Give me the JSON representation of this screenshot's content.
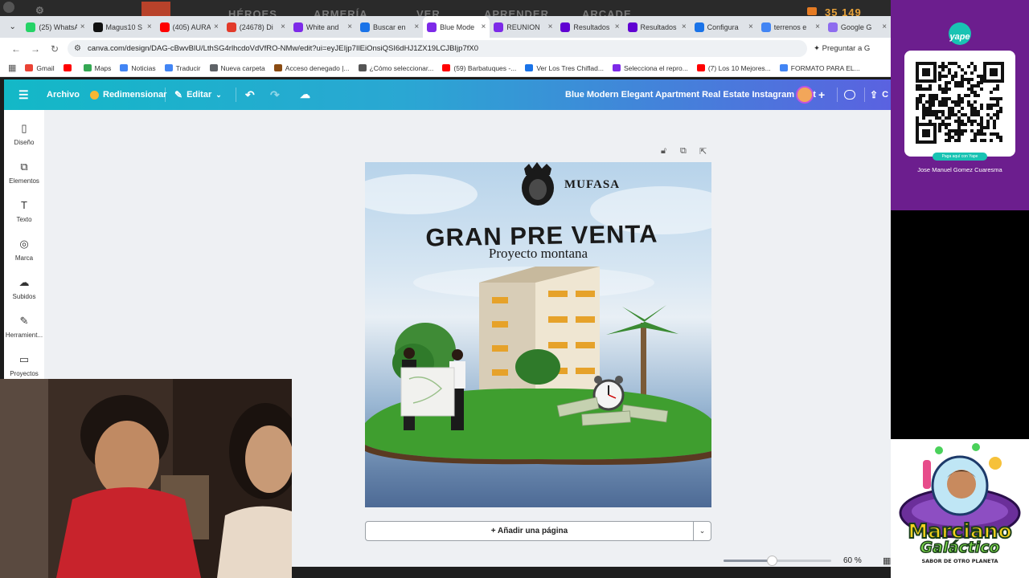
{
  "game_header": {
    "items": [
      "HÉROES",
      "ARMERÍA",
      "VER",
      "APRENDER",
      "ARCADE"
    ],
    "currency": "35 149"
  },
  "browser": {
    "tabs": [
      {
        "title": "(25) WhatsApp",
        "fav_color": "#25d366",
        "active": false
      },
      {
        "title": "Magus10 S",
        "fav_color": "#111111",
        "active": false
      },
      {
        "title": "(405) AURA",
        "fav_color": "#ff0000",
        "active": false
      },
      {
        "title": "(24678) Di",
        "fav_color": "#e23a2a",
        "active": false
      },
      {
        "title": "White and",
        "fav_color": "#7d2ae8",
        "active": false
      },
      {
        "title": "Buscar en",
        "fav_color": "#1a73e8",
        "active": false
      },
      {
        "title": "Blue Mode",
        "fav_color": "#7d2ae8",
        "active": true
      },
      {
        "title": "REUNION",
        "fav_color": "#7d2ae8",
        "active": false
      },
      {
        "title": "Resultados",
        "fav_color": "#6001d2",
        "active": false
      },
      {
        "title": "Resultados",
        "fav_color": "#6001d2",
        "active": false
      },
      {
        "title": "Configura",
        "fav_color": "#1a73e8",
        "active": false
      },
      {
        "title": "terrenos e",
        "fav_color": "#4285f4",
        "active": false
      },
      {
        "title": "Google G",
        "fav_color": "#8e6cef",
        "active": false
      }
    ],
    "url": "canva.com/design/DAG-cBwvBlU/LthSG4rlhcdoVdVfRO-NMw/edit?ui=eyJEIjp7IlEiOnsiQSI6dHJ1ZX19LCJBIjp7fX0",
    "ask_label": "Preguntar a G",
    "bookmarks": [
      {
        "label": "Gmail",
        "color": "#ea4335"
      },
      {
        "label": "",
        "color": "#ff0000"
      },
      {
        "label": "Maps",
        "color": "#34a853"
      },
      {
        "label": "Noticias",
        "color": "#4285f4"
      },
      {
        "label": "Traducir",
        "color": "#4285f4"
      },
      {
        "label": "Nueva carpeta",
        "color": "#5f6368"
      },
      {
        "label": "Acceso denegado |...",
        "color": "#8a4b12"
      },
      {
        "label": "¿Cómo seleccionar...",
        "color": "#555555"
      },
      {
        "label": "(59) Barbatuques -...",
        "color": "#ff0000"
      },
      {
        "label": "Ver Los Tres Chiflad...",
        "color": "#1a73e8"
      },
      {
        "label": "Selecciona el repro...",
        "color": "#7d2ae8"
      },
      {
        "label": "(7) Los 10 Mejores...",
        "color": "#ff0000"
      },
      {
        "label": "FORMATO PARA EL...",
        "color": "#4285f4"
      }
    ]
  },
  "canva": {
    "header": {
      "file": "Archivo",
      "resize": "Redimensionar",
      "edit": "Editar",
      "title": "Blue Modern Elegant Apartment Real Estate Instagram Post",
      "share_initial": "C"
    },
    "sidebar": [
      {
        "label": "Diseño",
        "icon": "layout-icon"
      },
      {
        "label": "Elementos",
        "icon": "elements-icon"
      },
      {
        "label": "Texto",
        "icon": "text-icon"
      },
      {
        "label": "Marca",
        "icon": "brand-icon"
      },
      {
        "label": "Subidos",
        "icon": "upload-cloud-icon"
      },
      {
        "label": "Herramient...",
        "icon": "tools-icon"
      },
      {
        "label": "Proyectos",
        "icon": "folder-icon"
      }
    ],
    "design": {
      "brand": "MUFASA",
      "headline": "GRAN PRE VENTA",
      "subhead": "Proyecto montana"
    },
    "add_page": "+ Añadir una página",
    "zoom": {
      "label": "60 %",
      "value": 0.45
    }
  },
  "yape": {
    "logo": "yape",
    "pay_label": "Paga aquí con Yape",
    "name": "Jose Manuel Gomez Cuaresma",
    "color": "#6c1e8e"
  },
  "marciano": {
    "title_line1": "Marciano",
    "title_line2": "Galáctico",
    "tagline": "SABOR DE OTRO PLANETA"
  }
}
